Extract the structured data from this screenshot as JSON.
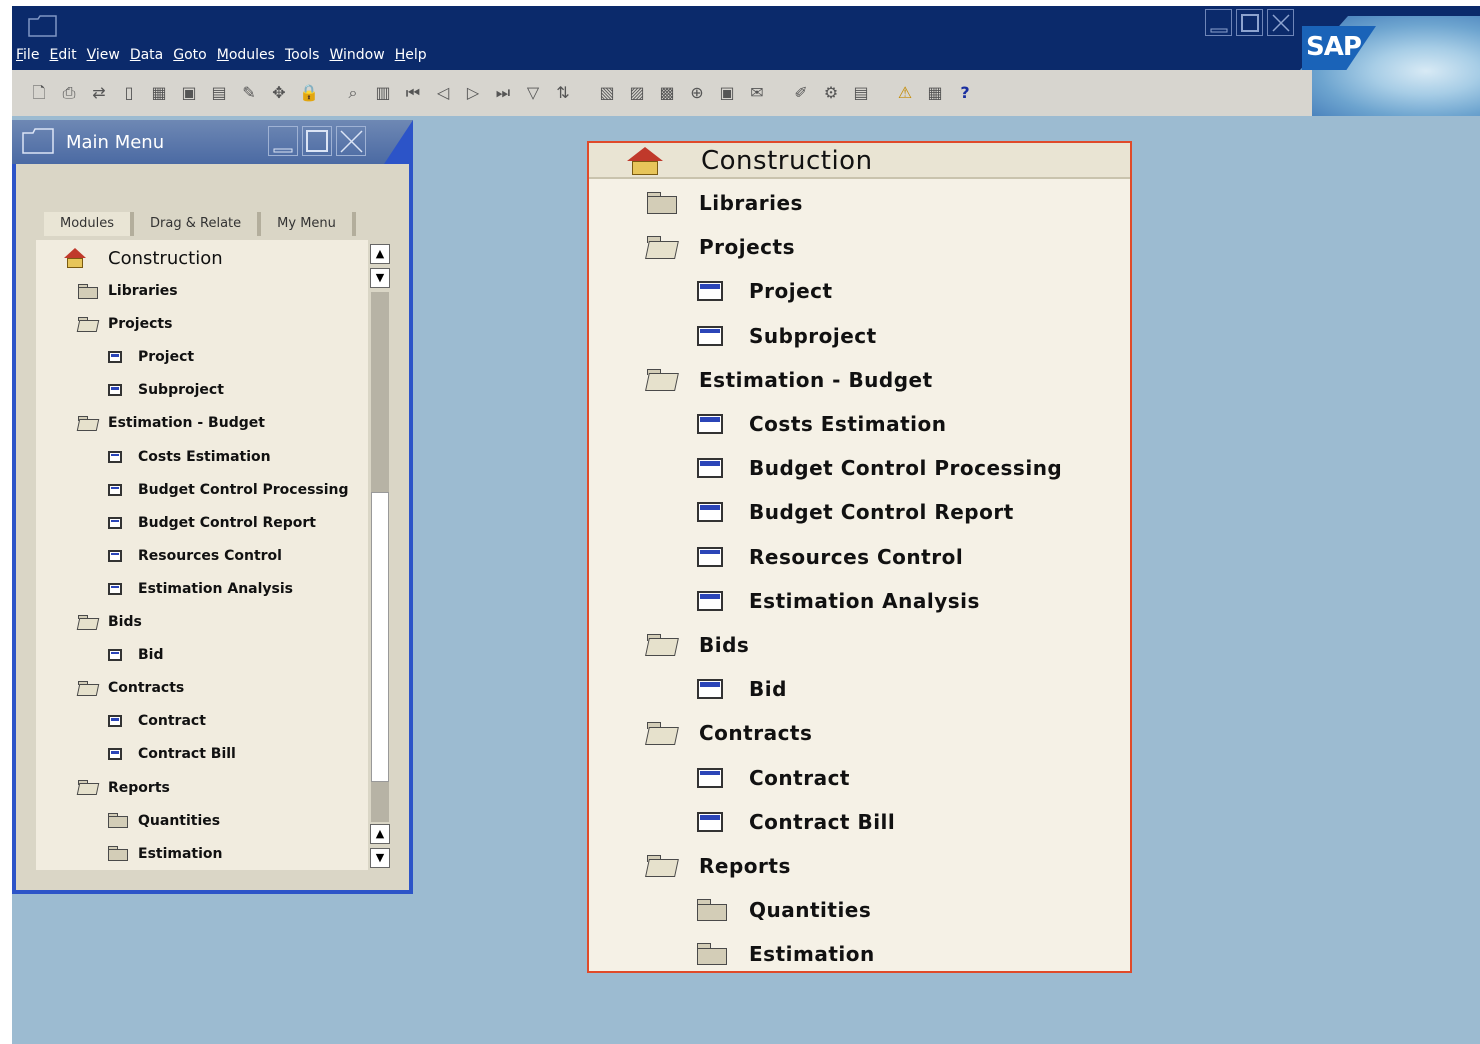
{
  "window": {
    "menu": [
      {
        "label": "File",
        "u": "F",
        "rest": "ile"
      },
      {
        "label": "Edit",
        "u": "E",
        "rest": "dit"
      },
      {
        "label": "View",
        "u": "V",
        "rest": "iew"
      },
      {
        "label": "Data",
        "u": "D",
        "rest": "ata"
      },
      {
        "label": "Goto",
        "u": "G",
        "rest": "oto"
      },
      {
        "label": "Modules",
        "u": "M",
        "rest": "odules"
      },
      {
        "label": "Tools",
        "u": "T",
        "rest": "ools"
      },
      {
        "label": "Window",
        "u": "W",
        "rest": "indow"
      },
      {
        "label": "Help",
        "u": "H",
        "rest": "elp"
      }
    ],
    "brand": "SAP"
  },
  "toolbar": {
    "icons": [
      "preview-icon",
      "print-icon",
      "connect-icon",
      "mobile-icon",
      "calculator-icon",
      "excel-icon",
      "word-icon",
      "draft-icon",
      "move-icon",
      "lock-icon",
      "find-icon",
      "find-next-icon",
      "first-record-icon",
      "previous-record-icon",
      "next-record-icon",
      "last-record-icon",
      "filter-icon",
      "sort-icon",
      "base-document-icon",
      "target-document-icon",
      "transaction-journal-icon",
      "payment-icon",
      "gross-profit-icon",
      "message-icon",
      "edit-icon",
      "settings-icon",
      "report-icon",
      "alert-icon",
      "calendar-icon",
      "help-icon"
    ]
  },
  "main_menu": {
    "title": "Main Menu",
    "tabs": [
      {
        "label": "Modules",
        "u_index": 2
      },
      {
        "label": "Drag & Relate",
        "u_index": 1
      },
      {
        "label": "My Menu",
        "u_index": 1
      }
    ],
    "scroll_glyph_up": "▲",
    "scroll_glyph_down": "▼"
  },
  "tree": {
    "root": "Construction",
    "items": [
      {
        "label": "Libraries",
        "level": 1,
        "type": "folder"
      },
      {
        "label": "Projects",
        "level": 1,
        "type": "folder-open"
      },
      {
        "label": "Project",
        "level": 2,
        "type": "node"
      },
      {
        "label": "Subproject",
        "level": 2,
        "type": "node"
      },
      {
        "label": "Estimation - Budget",
        "level": 1,
        "type": "folder-open"
      },
      {
        "label": "Costs Estimation",
        "level": 2,
        "type": "node"
      },
      {
        "label": "Budget Control Processing",
        "level": 2,
        "type": "node"
      },
      {
        "label": "Budget Control Report",
        "level": 2,
        "type": "node"
      },
      {
        "label": "Resources Control",
        "level": 2,
        "type": "node"
      },
      {
        "label": "Estimation Analysis",
        "level": 2,
        "type": "node"
      },
      {
        "label": "Bids",
        "level": 1,
        "type": "folder-open"
      },
      {
        "label": "Bid",
        "level": 2,
        "type": "node"
      },
      {
        "label": "Contracts",
        "level": 1,
        "type": "folder-open"
      },
      {
        "label": "Contract",
        "level": 2,
        "type": "node"
      },
      {
        "label": "Contract Bill",
        "level": 2,
        "type": "node"
      },
      {
        "label": "Reports",
        "level": 1,
        "type": "folder-open"
      },
      {
        "label": "Quantities",
        "level": 2,
        "type": "folder"
      },
      {
        "label": "Estimation",
        "level": 2,
        "type": "folder"
      }
    ]
  }
}
